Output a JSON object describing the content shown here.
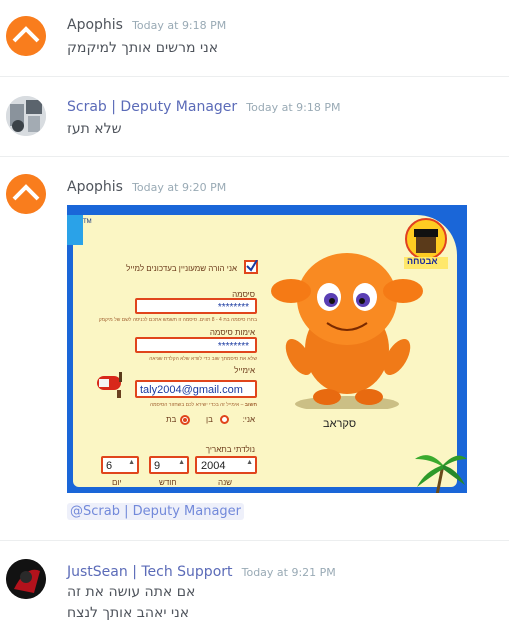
{
  "messages": [
    {
      "username": "Apophis",
      "timestamp": "Today at 9:18 PM",
      "lines": [
        "אני מרשים אותך למיקמק"
      ],
      "name_color": "#4f545c"
    },
    {
      "username": "Scrab | Deputy Manager",
      "timestamp": "Today at 9:18 PM",
      "lines": [
        "שלא תעז"
      ],
      "name_color": "#5b6bb8"
    },
    {
      "username": "Apophis",
      "timestamp": "Today at 9:20 PM",
      "mention": "@Scrab | Deputy Manager",
      "name_color": "#4f545c"
    },
    {
      "username": "JustSean | Tech Support",
      "timestamp": "Today at 9:21 PM",
      "lines": [
        "אם אתה עושה את זה",
        "אני יאהב אותך לנצח"
      ],
      "name_color": "#5b6bb8"
    }
  ],
  "embed": {
    "checkbox_label": "אני הורה שמעוניין בעדכונים למייל",
    "password_label": "סיסמה",
    "password_value": "********",
    "password_hint": "בחרו סיסמה בת 4 - 8 תווים. סיסמה זו תשמש אתכם לכניסה לשם של מיקמק",
    "confirm_label": "אימות סיסמה",
    "confirm_value": "********",
    "confirm_hint": "שלא את סיסמתך שוב כדי לוודא שלא הקלדת שגיאה",
    "email_label": "אימייל",
    "email_value": "taly2004@gmail.com",
    "email_note_bold": "חשוב",
    "email_note": "– אימייל זה בכדי ישירא לכם בשחזור הסיסמה",
    "gender_label": "אני:",
    "gender_boy": "בן",
    "gender_girl": "בת",
    "dob_label": "נולדתי בתאריך",
    "day_value": "6",
    "month_value": "9",
    "year_value": "2004",
    "day_label": "יום",
    "month_label": "חודש",
    "year_label": "שנה",
    "character_name": "סקראב",
    "badge_text": "אבטחה",
    "tm": "TM"
  },
  "colors": {
    "accent_link": "#7289da",
    "timestamp": "#99aab5",
    "field_border": "#e0451c",
    "embed_frame": "#1a66d8"
  }
}
